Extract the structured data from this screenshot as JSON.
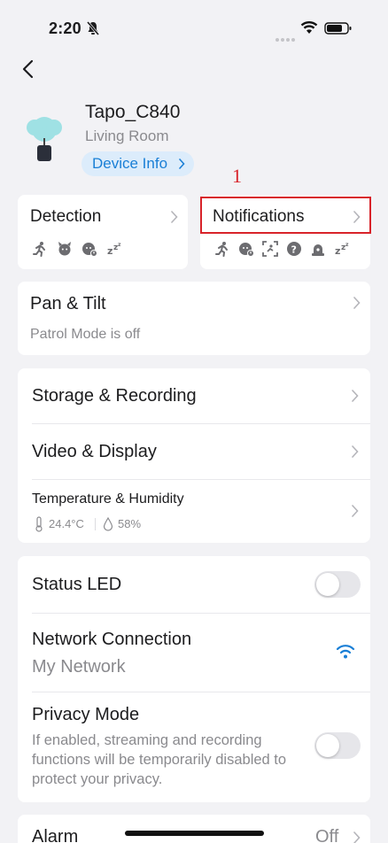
{
  "status_bar": {
    "time": "2:20"
  },
  "device": {
    "name": "Tapo_C840",
    "room": "Living Room",
    "info_label": "Device Info"
  },
  "annotation": {
    "number": "1"
  },
  "detection": {
    "label": "Detection",
    "icons": [
      "person-motion-icon",
      "pet-icon",
      "baby-cry-icon",
      "sleep-icon"
    ]
  },
  "notifications": {
    "label": "Notifications",
    "icons": [
      "person-motion-icon",
      "baby-cry-icon",
      "area-intrusion-icon",
      "unknown-sound-icon",
      "alarm-icon",
      "sleep-icon"
    ]
  },
  "pan_tilt": {
    "label": "Pan & Tilt",
    "status": "Patrol Mode is off"
  },
  "storage": {
    "label": "Storage & Recording"
  },
  "video": {
    "label": "Video & Display"
  },
  "temperature": {
    "label": "Temperature & Humidity",
    "temp": "24.4°C",
    "humidity": "58%"
  },
  "status_led": {
    "label": "Status LED",
    "enabled": false
  },
  "network": {
    "label": "Network Connection",
    "name": "My Network"
  },
  "privacy": {
    "label": "Privacy Mode",
    "description": "If enabled, streaming and recording functions will be temporarily disabled to protect your privacy.",
    "enabled": false
  },
  "alarm": {
    "label": "Alarm",
    "value": "Off"
  },
  "colors": {
    "accent": "#1a7fd6",
    "annotation": "#d8232a",
    "background": "#f2f2f5"
  }
}
